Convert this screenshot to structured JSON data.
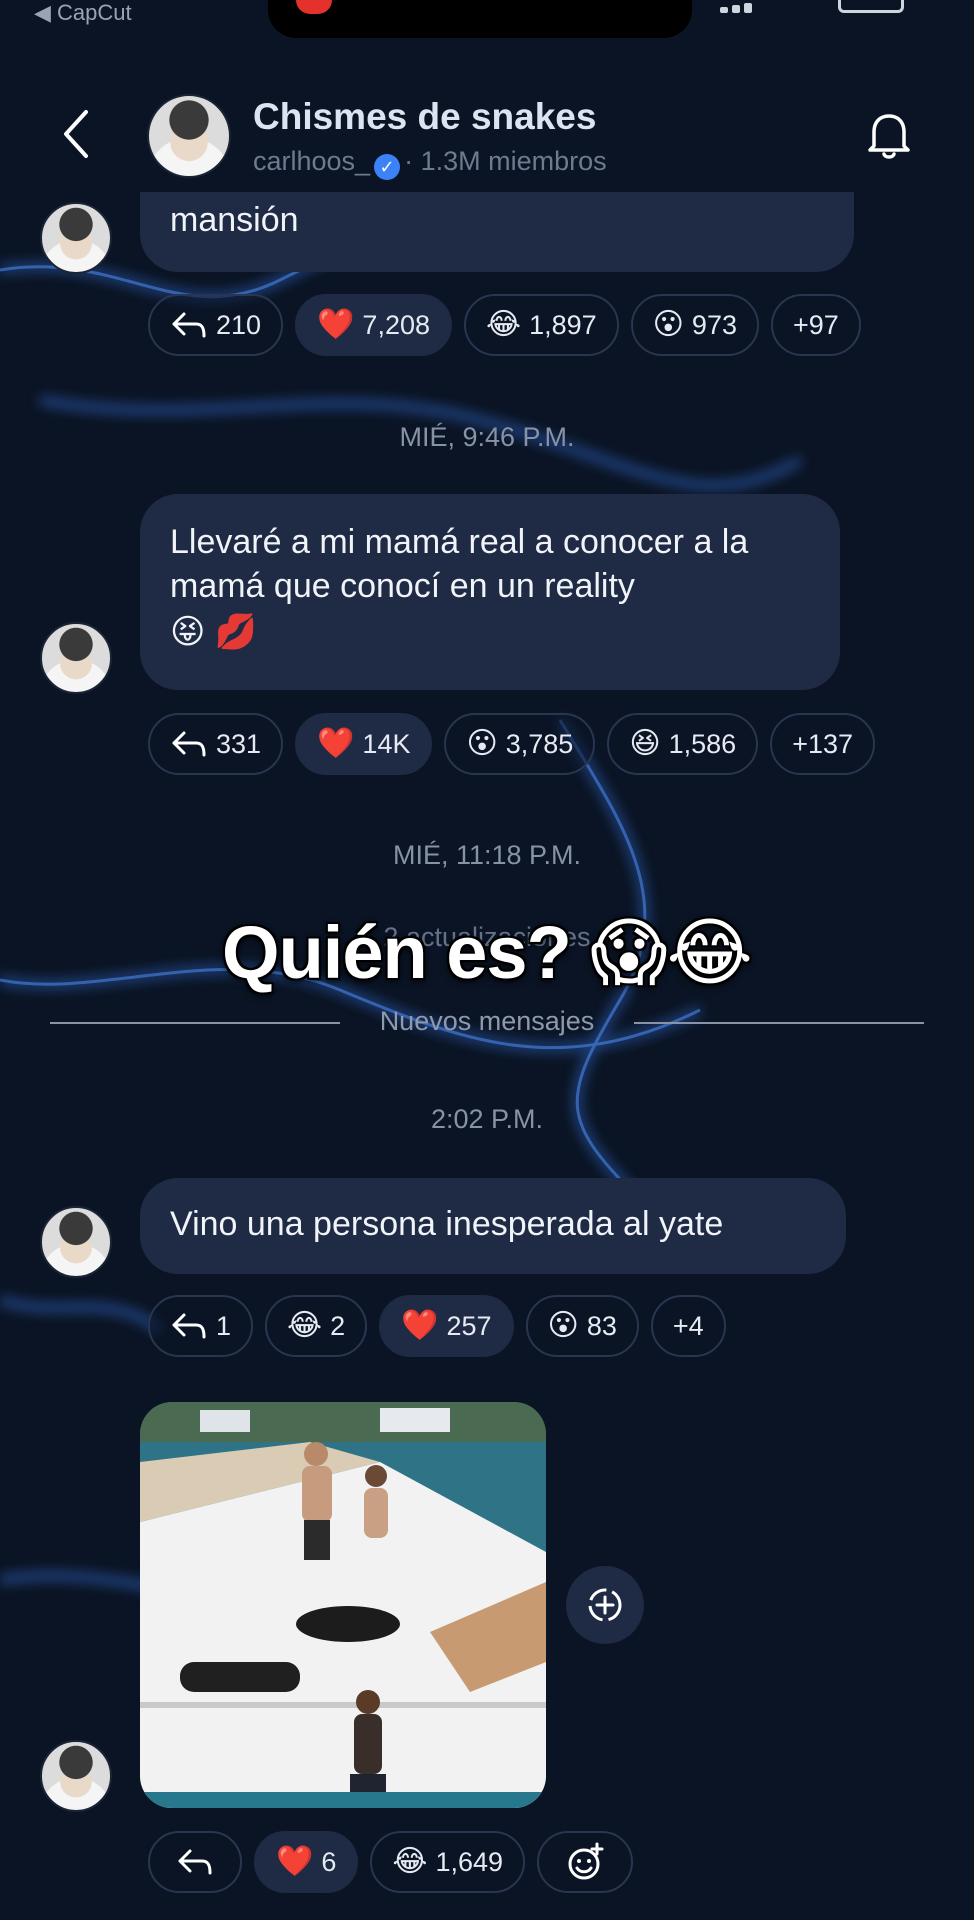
{
  "status_bar": {
    "back_app": "◀ CapCut"
  },
  "header": {
    "title": "Chismes de snakes",
    "handle": "carlhoos_",
    "members": "· 1.3M miembros"
  },
  "messages": [
    {
      "text": "mansión",
      "reactions": [
        {
          "icon": "reply-icon",
          "count": "210"
        },
        {
          "emoji": "❤️",
          "count": "7,208",
          "active": true
        },
        {
          "emoji": "😂",
          "count": "1,897"
        },
        {
          "emoji": "😮",
          "count": "973"
        },
        {
          "count": "+97"
        }
      ]
    },
    {
      "timestamp": "MIÉ, 9:46 P.M.",
      "text": "Llevaré a mi mamá real a conocer a la mamá que conocí en un reality",
      "emojis": "😝 💋",
      "reactions": [
        {
          "icon": "reply-icon",
          "count": "331"
        },
        {
          "emoji": "❤️",
          "count": "14K",
          "active": true
        },
        {
          "emoji": "😮",
          "count": "3,785"
        },
        {
          "emoji": "😆",
          "count": "1,586"
        },
        {
          "count": "+137"
        }
      ]
    },
    {
      "timestamp": "2:02 P.M.",
      "text": "Vino una persona inesperada al yate",
      "reactions": [
        {
          "icon": "reply-icon",
          "count": "1"
        },
        {
          "emoji": "😂",
          "count": "2"
        },
        {
          "emoji": "❤️",
          "count": "257",
          "active": true
        },
        {
          "emoji": "😮",
          "count": "83"
        },
        {
          "count": "+4"
        }
      ]
    },
    {
      "image": "yacht-photo",
      "reactions": [
        {
          "icon": "reply-icon",
          "count": ""
        },
        {
          "emoji": "❤️",
          "count": "6",
          "active": true
        },
        {
          "emoji": "😂",
          "count": "1,649"
        },
        {
          "icon": "add-reaction-icon",
          "count": ""
        }
      ]
    }
  ],
  "timestamp_middle": "MIÉ, 11:18 P.M.",
  "updates_text": "2 actualizaciones",
  "caption_overlay": "Quién es? 😱😂",
  "divider_label": "Nuevos mensajes",
  "colors": {
    "bg": "#0b1424",
    "bubble": "#1f2a44",
    "accent_blue": "#3b82f6"
  }
}
